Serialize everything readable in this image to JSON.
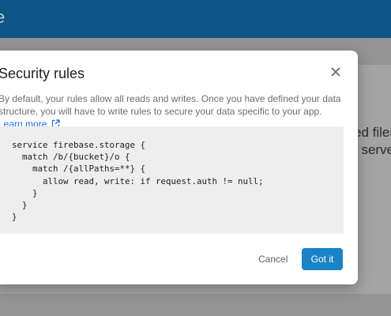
{
  "app_bar": {
    "title": "e"
  },
  "background": {
    "line1": "ed files",
    "line2": "t serve"
  },
  "dialog": {
    "title": "Security rules",
    "description": "By default, your rules allow all reads and writes. Once you have defined your data structure, you will have to write rules to secure your data specific to your app.",
    "learn_more": "Learn more",
    "code": "service firebase.storage {\n  match /b/{bucket}/o {\n    match /{allPaths=**} {\n      allow read, write: if request.auth != null;\n    }\n  }\n}",
    "cancel_label": "Cancel",
    "confirm_label": "Got it"
  },
  "colors": {
    "app_bar": "#0c5585",
    "link": "#1a73e8",
    "primary_button": "#1a83c6",
    "code_background": "#eeeeee"
  },
  "icons": {
    "close": "close-icon",
    "external_link": "external-link-icon"
  }
}
